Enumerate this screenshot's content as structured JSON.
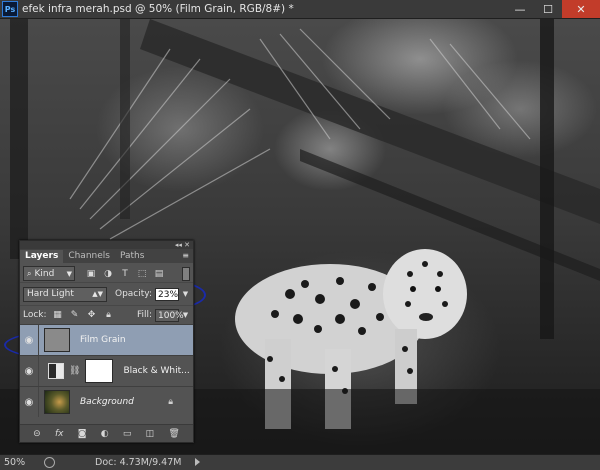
{
  "titlebar": {
    "app_icon": "Ps",
    "document_title": "efek infra merah.psd @ 50% (Film Grain, RGB/8#) *",
    "minimize": "—",
    "maximize": "☐",
    "close": "✕"
  },
  "panel": {
    "collapse_glyph": "◂◂ ✕",
    "tabs": [
      {
        "label": "Layers",
        "active": true
      },
      {
        "label": "Channels",
        "active": false
      },
      {
        "label": "Paths",
        "active": false
      }
    ],
    "menu_glyph": "≡",
    "filter": {
      "kind_label": "Kind",
      "icons": [
        "image-filter-icon",
        "adjustment-filter-icon",
        "type-filter-icon",
        "shape-filter-icon",
        "smart-object-filter-icon"
      ]
    },
    "blend_mode": "Hard Light",
    "opacity_label": "Opacity:",
    "opacity_value": "23%",
    "lock_label": "Lock:",
    "fill_label": "Fill:",
    "fill_value": "100%",
    "layers": [
      {
        "name": "Film Grain",
        "selected": true,
        "visible": true
      },
      {
        "name": "Black & Whit...",
        "selected": false,
        "visible": true
      },
      {
        "name": "Background",
        "selected": false,
        "visible": true,
        "locked": true
      }
    ],
    "bottom_icons": [
      "link-icon",
      "fx-icon",
      "mask-icon",
      "adjustment-icon",
      "group-icon",
      "new-layer-icon",
      "trash-icon"
    ]
  },
  "statusbar": {
    "zoom": "50%",
    "doc_info": "Doc: 4.73M/9.47M"
  },
  "colors": {
    "highlight_ellipse": "#1a2aa8",
    "selected_layer": "#8f9eb3",
    "close_button": "#c23c2a"
  }
}
